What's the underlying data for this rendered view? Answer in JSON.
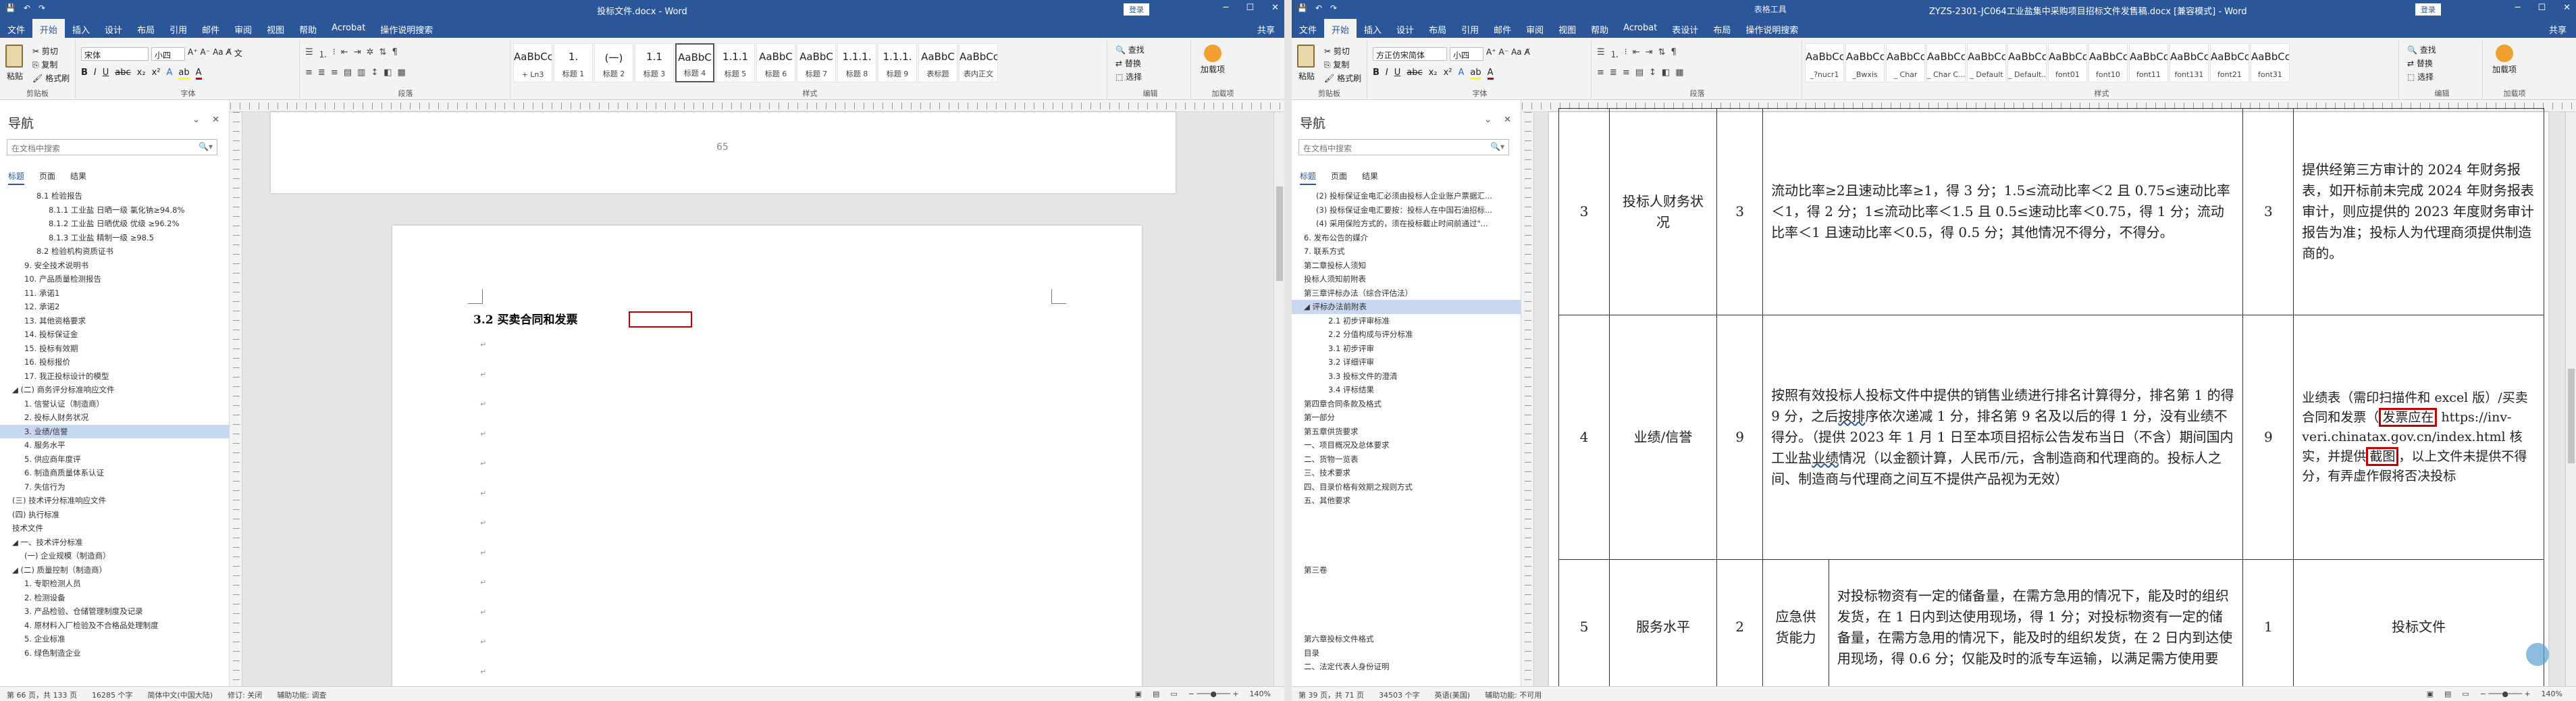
{
  "left": {
    "title": "投标文件.docx - Word",
    "login": "登录",
    "share": "共享",
    "tabs": [
      "文件",
      "开始",
      "插入",
      "设计",
      "布局",
      "引用",
      "邮件",
      "审阅",
      "视图",
      "帮助",
      "Acrobat",
      "操作说明搜索"
    ],
    "clipboard": {
      "paste": "粘贴",
      "cut": "剪切",
      "copy": "复制",
      "format_painter": "格式刷",
      "label": "剪贴板"
    },
    "font": {
      "name": "宋体",
      "size": "小四",
      "label": "字体",
      "fmt": [
        "B",
        "I",
        "U",
        "abc",
        "x₂",
        "x²",
        "A",
        "A"
      ]
    },
    "paragraph": {
      "label": "段落"
    },
    "styles": {
      "label": "样式",
      "items": [
        {
          "p": "AaBbCcI",
          "n": "+ Ln3"
        },
        {
          "p": "1.",
          "n": "标题 1"
        },
        {
          "p": "(一)",
          "n": "标题 2"
        },
        {
          "p": "1.1",
          "n": "标题 3"
        },
        {
          "p": "AaBbC",
          "n": "标题 4"
        },
        {
          "p": "1.1.1",
          "n": "标题 5"
        },
        {
          "p": "AaBbC",
          "n": "标题 6"
        },
        {
          "p": "AaBbC",
          "n": "标题 7"
        },
        {
          "p": "1.1.1.",
          "n": "标题 8"
        },
        {
          "p": "1.1.1.",
          "n": "标题 9"
        },
        {
          "p": "AaBbC",
          "n": "表标题"
        },
        {
          "p": "AaBbCcI",
          "n": "表内正文"
        }
      ]
    },
    "editing": {
      "find": "查找",
      "replace": "替换",
      "select": "选择",
      "label": "编辑"
    },
    "addin": {
      "name": "加载项",
      "label": "加载项"
    },
    "nav": {
      "title": "导航",
      "search": "在文档中搜索",
      "tabs": [
        "标题",
        "页面",
        "结果"
      ],
      "items": [
        {
          "t": "8.1 检验报告",
          "i": 2,
          "s": false
        },
        {
          "t": "8.1.1 工业盐 日晒一级 氯化钠≥94.8%",
          "i": 3,
          "s": false
        },
        {
          "t": "8.1.2 工业盐 日晒优级 优级 ≥96.2%",
          "i": 3,
          "s": false
        },
        {
          "t": "8.1.3 工业盐 精制一级 ≥98.5",
          "i": 3,
          "s": false
        },
        {
          "t": "8.2 检验机构资质证书",
          "i": 2,
          "s": false
        },
        {
          "t": "9. 安全技术说明书",
          "i": 1,
          "s": false
        },
        {
          "t": "10. 产品质量检测报告",
          "i": 1,
          "s": false
        },
        {
          "t": "11. 承诺1",
          "i": 1,
          "s": false
        },
        {
          "t": "12. 承诺2",
          "i": 1,
          "s": false
        },
        {
          "t": "13. 其他资格要求",
          "i": 1,
          "s": false
        },
        {
          "t": "14. 投标保证金",
          "i": 1,
          "s": false
        },
        {
          "t": "15. 投标有效期",
          "i": 1,
          "s": false
        },
        {
          "t": "16. 投标报价",
          "i": 1,
          "s": false
        },
        {
          "t": "17. 我正投标设计的模型",
          "i": 1,
          "s": false
        },
        {
          "t": "◢ (二) 商务评分标准响应文件",
          "i": 0,
          "s": false
        },
        {
          "t": "1. 信誉认证（制造商）",
          "i": 1,
          "s": false
        },
        {
          "t": "2. 投标人财务状况",
          "i": 1,
          "s": false
        },
        {
          "t": "3. 业绩/信誉",
          "i": 1,
          "s": true
        },
        {
          "t": "4. 服务水平",
          "i": 1,
          "s": false
        },
        {
          "t": "5. 供应商年度评",
          "i": 1,
          "s": false
        },
        {
          "t": "6. 制造商质量体系认证",
          "i": 1,
          "s": false
        },
        {
          "t": "7. 失信行为",
          "i": 1,
          "s": false
        },
        {
          "t": "(三) 技术评分标准响应文件",
          "i": 0,
          "s": false
        },
        {
          "t": "(四) 执行标准",
          "i": 0,
          "s": false
        },
        {
          "t": "技术文件",
          "i": 0,
          "s": false
        },
        {
          "t": "◢ 一、技术评分标准",
          "i": 0,
          "s": false
        },
        {
          "t": "(一) 企业规模（制造商）",
          "i": 1,
          "s": false
        },
        {
          "t": "◢ (二) 质量控制（制造商）",
          "i": 0,
          "s": false
        },
        {
          "t": "1. 专职检测人员",
          "i": 1,
          "s": false
        },
        {
          "t": "2. 检测设备",
          "i": 1,
          "s": false
        },
        {
          "t": "3. 产品检验、仓储管理制度及记录",
          "i": 1,
          "s": false
        },
        {
          "t": "4. 原材料入厂检验及不合格品处理制度",
          "i": 1,
          "s": false
        },
        {
          "t": "5. 企业标准",
          "i": 1,
          "s": false
        },
        {
          "t": "6. 绿色制造企业",
          "i": 1,
          "s": false
        }
      ]
    },
    "page_number": "65",
    "heading": "3.2 买卖合同和发票",
    "status": {
      "page": "第 66 页，共 133 页",
      "words": "16285 个字",
      "lang": "简体中文(中国大陆)",
      "track": "修订: 关闭",
      "access": "辅助功能: 调查",
      "zoom": "140%"
    }
  },
  "right": {
    "title": "ZYZS-2301-JC064工业盐集中采购项目招标文件发售稿.docx [兼容模式] - Word",
    "tools": "表格工具",
    "login": "登录",
    "share": "共享",
    "tabs": [
      "文件",
      "开始",
      "插入",
      "设计",
      "布局",
      "引用",
      "邮件",
      "审阅",
      "视图",
      "帮助",
      "Acrobat",
      "表设计",
      "布局",
      "操作说明搜索"
    ],
    "clipboard": {
      "paste": "粘贴",
      "cut": "剪切",
      "copy": "复制",
      "format_painter": "格式刷",
      "label": "剪贴板"
    },
    "font": {
      "name": "方正仿宋简体",
      "size": "小四",
      "label": "字体"
    },
    "paragraph": {
      "label": "段落"
    },
    "styles": {
      "label": "样式",
      "items": [
        {
          "p": "AaBbCcI",
          "n": "_?nucr1"
        },
        {
          "p": "AaBbCcI",
          "n": "_Bwxis"
        },
        {
          "p": "AaBbCcI",
          "n": "_ Char"
        },
        {
          "p": "AaBbCcI",
          "n": "_ Char C..."
        },
        {
          "p": "AaBbCcDi",
          "n": "_ Default"
        },
        {
          "p": "AaBbCcDi",
          "n": "_ Default..."
        },
        {
          "p": "AaBbCcDd",
          "n": "font01"
        },
        {
          "p": "AaBbCcDi",
          "n": "font10"
        },
        {
          "p": "AaBbCcDi",
          "n": "font11"
        },
        {
          "p": "AaBbCcDd",
          "n": "font131"
        },
        {
          "p": "AaBbCcDi",
          "n": "font21"
        },
        {
          "p": "AaBbCcI",
          "n": "font31"
        }
      ]
    },
    "editing": {
      "find": "查找",
      "replace": "替换",
      "select": "选择",
      "label": "编辑"
    },
    "addin": {
      "name": "加载项",
      "label": "加载项"
    },
    "nav": {
      "title": "导航",
      "search": "在文档中搜索",
      "tabs": [
        "标题",
        "页面",
        "结果"
      ],
      "items": [
        {
          "t": "(2) 投标保证金电汇必须由投标人企业账户票据汇...",
          "i": 1,
          "s": false
        },
        {
          "t": "(3) 投标保证金电汇要按：投标人在中国石油招标...",
          "i": 1,
          "s": false
        },
        {
          "t": "(4) 采用保险方式的，须在投标截止时间前通过\"...",
          "i": 1,
          "s": false
        },
        {
          "t": "6. 发布公告的媒介",
          "i": 0,
          "s": false
        },
        {
          "t": "7. 联系方式",
          "i": 0,
          "s": false
        },
        {
          "t": "第二章投标人须知",
          "i": 0,
          "s": false
        },
        {
          "t": "投标人须知前附表",
          "i": 0,
          "s": false
        },
        {
          "t": "第三章评标办法（综合评估法）",
          "i": 0,
          "s": false
        },
        {
          "t": "◢ 评标办法前附表",
          "i": 0,
          "s": true
        },
        {
          "t": "2.1 初步评审标准",
          "i": 2,
          "s": false
        },
        {
          "t": "2.2 分值构成与评分标准",
          "i": 2,
          "s": false
        },
        {
          "t": "3.1 初步评审",
          "i": 2,
          "s": false
        },
        {
          "t": "3.2 详细评审",
          "i": 2,
          "s": false
        },
        {
          "t": "3.3 投标文件的澄清",
          "i": 2,
          "s": false
        },
        {
          "t": "3.4 评标结果",
          "i": 2,
          "s": false
        },
        {
          "t": "第四章合同条款及格式",
          "i": 0,
          "s": false
        },
        {
          "t": "第一部分",
          "i": 0,
          "s": false
        },
        {
          "t": "第五章供货要求",
          "i": 0,
          "s": false
        },
        {
          "t": "一、项目概况及总体要求",
          "i": 0,
          "s": false
        },
        {
          "t": "二、货物一览表",
          "i": 0,
          "s": false
        },
        {
          "t": "三、技术要求",
          "i": 0,
          "s": false
        },
        {
          "t": "四、目录价格有效期之规则方式",
          "i": 0,
          "s": false
        },
        {
          "t": "五、其他要求",
          "i": 0,
          "s": false
        },
        {
          "t": "",
          "i": 0,
          "s": false
        },
        {
          "t": "",
          "i": 0,
          "s": false
        },
        {
          "t": "",
          "i": 0,
          "s": false
        },
        {
          "t": "",
          "i": 0,
          "s": false
        },
        {
          "t": "第三卷",
          "i": 0,
          "s": false
        },
        {
          "t": "",
          "i": 0,
          "s": false
        },
        {
          "t": "",
          "i": 0,
          "s": false
        },
        {
          "t": "",
          "i": 0,
          "s": false
        },
        {
          "t": "",
          "i": 0,
          "s": false
        },
        {
          "t": "第六章投标文件格式",
          "i": 0,
          "s": false
        },
        {
          "t": "目录",
          "i": 0,
          "s": false
        },
        {
          "t": "二、法定代表人身份证明",
          "i": 0,
          "s": false
        }
      ]
    },
    "table": {
      "row3": {
        "no": "3",
        "item": "投标人财务状况",
        "score": "3",
        "criteria": "流动比率≥2且速动比率≥1，得 3 分；1.5≤流动比率＜2 且 0.75≤速动比率＜1，得 2 分；1≤流动比率＜1.5 且 0.5≤速动比率＜0.75，得 1 分；流动比率＜1 且速动比率＜0.5，得 0.5 分；其他情况不得分，不得分。",
        "score2": "3",
        "doc": "提供经第三方审计的 2024 年财务报表，如开标前未完成 2024 年财务报表审计，则应提供的 2023 年度财务审计报告为准；投标人为代理商须提供制造商的。"
      },
      "row4": {
        "no": "4",
        "item": "业绩/信誉",
        "score": "9",
        "criteria_a": "按照有效投标人投标文件中提供的销售业绩进行排名计算得分，排名第 1 的得 9 分，之后",
        "criteria_ul": "按排",
        "criteria_b": "序依次递减 1 分，排名第 9 名及以后的得 1 分，没有业绩不得分。（提供 2023 年 1 月 1 日至本项目招标公告发布当日（不含）期间国内工业盐",
        "criteria_ul2": "业绩",
        "criteria_c": "情况（以金额计算，人民币/元，含制造商和代理商的。投标人之间、制造商与代理商之间互不提供产品视为无效）",
        "score2": "9",
        "doc_a": "业绩表（需印扫描件和 excel 版）/买卖合同和发票（",
        "doc_box1": "发票应在",
        "doc_b": " https://inv-veri.chinatax.gov.cn/index.html 核实，并提供",
        "doc_box2": "截图",
        "doc_c": "，以上文件未提供不得分，有弄虚作假将否决投标"
      },
      "row5": {
        "no": "5",
        "item": "服务水平",
        "score": "2",
        "sub": "应急供货能力",
        "criteria": "对投标物资有一定的储备量，在需方急用的情况下，能及时的组织发货，在 1 日内到达使用现场，得 1 分；对投标物资有一定的储备量，在需方急用的情况下，能及时的组织发货，在 2 日内到达使用现场，得 0.6 分；仅能及时的派专车运输，以满足需方使用要",
        "score2": "1",
        "doc": "投标文件"
      }
    },
    "status": {
      "page": "第 39 页，共 71 页",
      "words": "34503 个字",
      "lang": "英语(美国)",
      "access": "辅助功能: 不可用",
      "zoom": "140%"
    }
  }
}
